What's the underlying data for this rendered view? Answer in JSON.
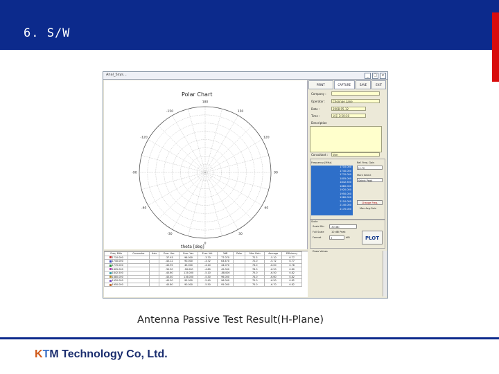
{
  "slide": {
    "title": "6. S/W",
    "caption": "Antenna Passive Test Result(H-Plane)",
    "company_k": "K",
    "company_t": "T",
    "company_m": "M",
    "company_rest": " Technology Co, Ltd.",
    "colors": {
      "header": "#0c2a8c",
      "accent_red": "#d80c0c"
    }
  },
  "window": {
    "title": "Anal_Ssys...",
    "min_glyph": "_",
    "max_glyph": "□",
    "close_glyph": "x"
  },
  "chart": {
    "title": "Polar Chart",
    "xlabel": "theta [deg]",
    "angle_labels": [
      "180",
      "150",
      "120",
      "90",
      "60",
      "30",
      "0",
      "-30",
      "-60",
      "-90",
      "-120",
      "-150"
    ]
  },
  "toolbar": {
    "print": "PRINT",
    "capture": "CAPTURE",
    "save": "SAVE",
    "exit": "EXIT"
  },
  "form": {
    "company_label": "Company :",
    "company_value": "",
    "operator_label": "Operator :",
    "operator_value": "Chonnae Lane",
    "date_label": "Date :",
    "date_value": "2008.05.12",
    "time_label": "Time :",
    "time_value": "오후 3:50:10",
    "description_label": "Description",
    "description_value": "",
    "consultant_label": "Consultant :",
    "consultant_value": "ktm"
  },
  "frequency": {
    "label": "Frequency [MHz]",
    "items": [
      "1710.000",
      "1740.000",
      "1770.000",
      "1805.000",
      "1842.500",
      "1880.000",
      "1920.000",
      "1950.000",
      "1980.000",
      "2110.000",
      "2140.000",
      "2170.000"
    ],
    "ref_freq_label": "Ref. Freq. Gain",
    "ref_freq_value": "(4.70",
    "mark_label": "Mark Select",
    "mark_value": "Select Peak",
    "change_button": "Change Freq.",
    "max_avg_label": "Max Avg.Gain"
  },
  "options": {
    "group_label": "Scale",
    "scale_label": "Scale Min",
    "scale_value": "-30 dBi",
    "full_scale_label": "Full Scale",
    "full_scale_value": "10 dBi Peak",
    "format_label": "Format",
    "format_value": "3",
    "format_unit": "dBi",
    "plot_button": "PLOT",
    "check_label": "Draw Values"
  },
  "table": {
    "headers": [
      "Freq. MHz",
      "Connector",
      "Axis",
      "Ecor. Hor.",
      "Ecor. Ver.",
      "Ecor. Vol.",
      "3dB",
      "Polar",
      "Max Gain",
      "Average",
      "Efficiency"
    ],
    "sub_headers": [
      "",
      "",
      "",
      "Value",
      "[deg]",
      "Value",
      "[deg]",
      "Value",
      "Pol. [deg]",
      "Pol. [deg]",
      "",
      "",
      ""
    ],
    "rows": [
      {
        "color": "#c83030",
        "cells": [
          "1710.000",
          "",
          "",
          "-37.93",
          "96.000",
          "-3.70",
          "77.070",
          "",
          "72.3",
          "-5.10",
          "0.77"
        ]
      },
      {
        "color": "#2f3fbf",
        "cells": [
          "1740.000",
          "",
          "",
          "-40.12",
          "90.000",
          "-3.72",
          "63.470",
          "",
          "72.0",
          "-5.72",
          "0.77"
        ]
      },
      {
        "color": "#1b8f2f",
        "cells": [
          "1770.000",
          "",
          "",
          "-40.95",
          "45.000",
          "-4.10",
          "44.070",
          "",
          "73.0",
          "-6.00",
          "0.78"
        ]
      },
      {
        "color": "#b03ab0",
        "cells": [
          "1805.000",
          "",
          "",
          "-39.50",
          "-26.000",
          "-4.80",
          "49.000",
          "",
          "76.0",
          "-6.20",
          "0.80"
        ]
      },
      {
        "color": "#2a9aa8",
        "cells": [
          "1842.500",
          "",
          "",
          "-40.60",
          "115.000",
          "-5.10",
          "-88.000",
          "",
          "75.0",
          "-6.50",
          "0.82"
        ]
      },
      {
        "color": "#b38a20",
        "cells": [
          "1880.000",
          "",
          "",
          "-40.40",
          "116.000",
          "-5.30",
          "96.000",
          "",
          "74.0",
          "-6.60",
          "0.82"
        ]
      },
      {
        "color": "#7a4fc8",
        "cells": [
          "1920.000",
          "",
          "",
          "-40.50",
          "95.000",
          "-5.40",
          "96.000",
          "",
          "75.0",
          "-6.50",
          "0.82"
        ]
      },
      {
        "color": "#c0692a",
        "cells": [
          "1950.000",
          "",
          "",
          "-40.80",
          "90.000",
          "-5.50",
          "95.000",
          "",
          "75.0",
          "-6.70",
          "0.82"
        ]
      }
    ]
  }
}
